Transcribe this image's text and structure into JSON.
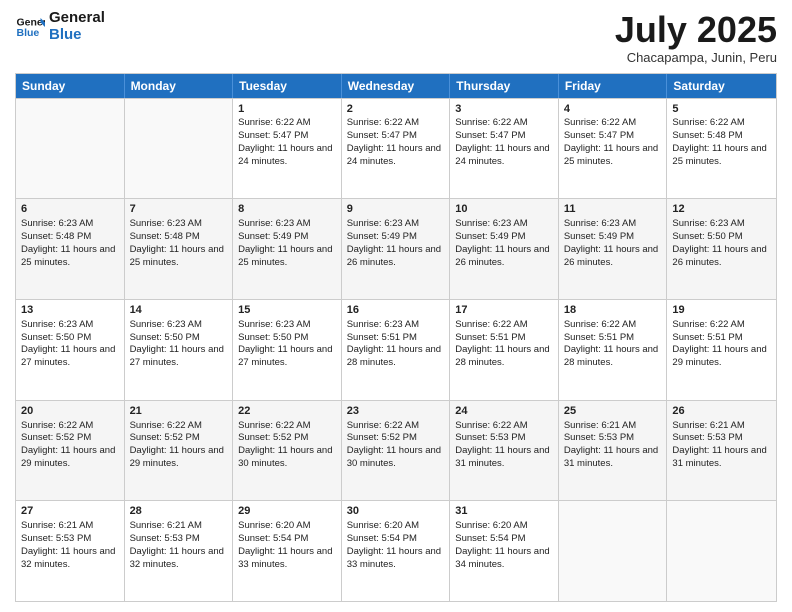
{
  "logo": {
    "line1": "General",
    "line2": "Blue"
  },
  "title": "July 2025",
  "subtitle": "Chacapampa, Junin, Peru",
  "headers": [
    "Sunday",
    "Monday",
    "Tuesday",
    "Wednesday",
    "Thursday",
    "Friday",
    "Saturday"
  ],
  "weeks": [
    [
      {
        "day": "",
        "sunrise": "",
        "sunset": "",
        "daylight": ""
      },
      {
        "day": "",
        "sunrise": "",
        "sunset": "",
        "daylight": ""
      },
      {
        "day": "1",
        "sunrise": "Sunrise: 6:22 AM",
        "sunset": "Sunset: 5:47 PM",
        "daylight": "Daylight: 11 hours and 24 minutes."
      },
      {
        "day": "2",
        "sunrise": "Sunrise: 6:22 AM",
        "sunset": "Sunset: 5:47 PM",
        "daylight": "Daylight: 11 hours and 24 minutes."
      },
      {
        "day": "3",
        "sunrise": "Sunrise: 6:22 AM",
        "sunset": "Sunset: 5:47 PM",
        "daylight": "Daylight: 11 hours and 24 minutes."
      },
      {
        "day": "4",
        "sunrise": "Sunrise: 6:22 AM",
        "sunset": "Sunset: 5:47 PM",
        "daylight": "Daylight: 11 hours and 25 minutes."
      },
      {
        "day": "5",
        "sunrise": "Sunrise: 6:22 AM",
        "sunset": "Sunset: 5:48 PM",
        "daylight": "Daylight: 11 hours and 25 minutes."
      }
    ],
    [
      {
        "day": "6",
        "sunrise": "Sunrise: 6:23 AM",
        "sunset": "Sunset: 5:48 PM",
        "daylight": "Daylight: 11 hours and 25 minutes."
      },
      {
        "day": "7",
        "sunrise": "Sunrise: 6:23 AM",
        "sunset": "Sunset: 5:48 PM",
        "daylight": "Daylight: 11 hours and 25 minutes."
      },
      {
        "day": "8",
        "sunrise": "Sunrise: 6:23 AM",
        "sunset": "Sunset: 5:49 PM",
        "daylight": "Daylight: 11 hours and 25 minutes."
      },
      {
        "day": "9",
        "sunrise": "Sunrise: 6:23 AM",
        "sunset": "Sunset: 5:49 PM",
        "daylight": "Daylight: 11 hours and 26 minutes."
      },
      {
        "day": "10",
        "sunrise": "Sunrise: 6:23 AM",
        "sunset": "Sunset: 5:49 PM",
        "daylight": "Daylight: 11 hours and 26 minutes."
      },
      {
        "day": "11",
        "sunrise": "Sunrise: 6:23 AM",
        "sunset": "Sunset: 5:49 PM",
        "daylight": "Daylight: 11 hours and 26 minutes."
      },
      {
        "day": "12",
        "sunrise": "Sunrise: 6:23 AM",
        "sunset": "Sunset: 5:50 PM",
        "daylight": "Daylight: 11 hours and 26 minutes."
      }
    ],
    [
      {
        "day": "13",
        "sunrise": "Sunrise: 6:23 AM",
        "sunset": "Sunset: 5:50 PM",
        "daylight": "Daylight: 11 hours and 27 minutes."
      },
      {
        "day": "14",
        "sunrise": "Sunrise: 6:23 AM",
        "sunset": "Sunset: 5:50 PM",
        "daylight": "Daylight: 11 hours and 27 minutes."
      },
      {
        "day": "15",
        "sunrise": "Sunrise: 6:23 AM",
        "sunset": "Sunset: 5:50 PM",
        "daylight": "Daylight: 11 hours and 27 minutes."
      },
      {
        "day": "16",
        "sunrise": "Sunrise: 6:23 AM",
        "sunset": "Sunset: 5:51 PM",
        "daylight": "Daylight: 11 hours and 28 minutes."
      },
      {
        "day": "17",
        "sunrise": "Sunrise: 6:22 AM",
        "sunset": "Sunset: 5:51 PM",
        "daylight": "Daylight: 11 hours and 28 minutes."
      },
      {
        "day": "18",
        "sunrise": "Sunrise: 6:22 AM",
        "sunset": "Sunset: 5:51 PM",
        "daylight": "Daylight: 11 hours and 28 minutes."
      },
      {
        "day": "19",
        "sunrise": "Sunrise: 6:22 AM",
        "sunset": "Sunset: 5:51 PM",
        "daylight": "Daylight: 11 hours and 29 minutes."
      }
    ],
    [
      {
        "day": "20",
        "sunrise": "Sunrise: 6:22 AM",
        "sunset": "Sunset: 5:52 PM",
        "daylight": "Daylight: 11 hours and 29 minutes."
      },
      {
        "day": "21",
        "sunrise": "Sunrise: 6:22 AM",
        "sunset": "Sunset: 5:52 PM",
        "daylight": "Daylight: 11 hours and 29 minutes."
      },
      {
        "day": "22",
        "sunrise": "Sunrise: 6:22 AM",
        "sunset": "Sunset: 5:52 PM",
        "daylight": "Daylight: 11 hours and 30 minutes."
      },
      {
        "day": "23",
        "sunrise": "Sunrise: 6:22 AM",
        "sunset": "Sunset: 5:52 PM",
        "daylight": "Daylight: 11 hours and 30 minutes."
      },
      {
        "day": "24",
        "sunrise": "Sunrise: 6:22 AM",
        "sunset": "Sunset: 5:53 PM",
        "daylight": "Daylight: 11 hours and 31 minutes."
      },
      {
        "day": "25",
        "sunrise": "Sunrise: 6:21 AM",
        "sunset": "Sunset: 5:53 PM",
        "daylight": "Daylight: 11 hours and 31 minutes."
      },
      {
        "day": "26",
        "sunrise": "Sunrise: 6:21 AM",
        "sunset": "Sunset: 5:53 PM",
        "daylight": "Daylight: 11 hours and 31 minutes."
      }
    ],
    [
      {
        "day": "27",
        "sunrise": "Sunrise: 6:21 AM",
        "sunset": "Sunset: 5:53 PM",
        "daylight": "Daylight: 11 hours and 32 minutes."
      },
      {
        "day": "28",
        "sunrise": "Sunrise: 6:21 AM",
        "sunset": "Sunset: 5:53 PM",
        "daylight": "Daylight: 11 hours and 32 minutes."
      },
      {
        "day": "29",
        "sunrise": "Sunrise: 6:20 AM",
        "sunset": "Sunset: 5:54 PM",
        "daylight": "Daylight: 11 hours and 33 minutes."
      },
      {
        "day": "30",
        "sunrise": "Sunrise: 6:20 AM",
        "sunset": "Sunset: 5:54 PM",
        "daylight": "Daylight: 11 hours and 33 minutes."
      },
      {
        "day": "31",
        "sunrise": "Sunrise: 6:20 AM",
        "sunset": "Sunset: 5:54 PM",
        "daylight": "Daylight: 11 hours and 34 minutes."
      },
      {
        "day": "",
        "sunrise": "",
        "sunset": "",
        "daylight": ""
      },
      {
        "day": "",
        "sunrise": "",
        "sunset": "",
        "daylight": ""
      }
    ]
  ]
}
